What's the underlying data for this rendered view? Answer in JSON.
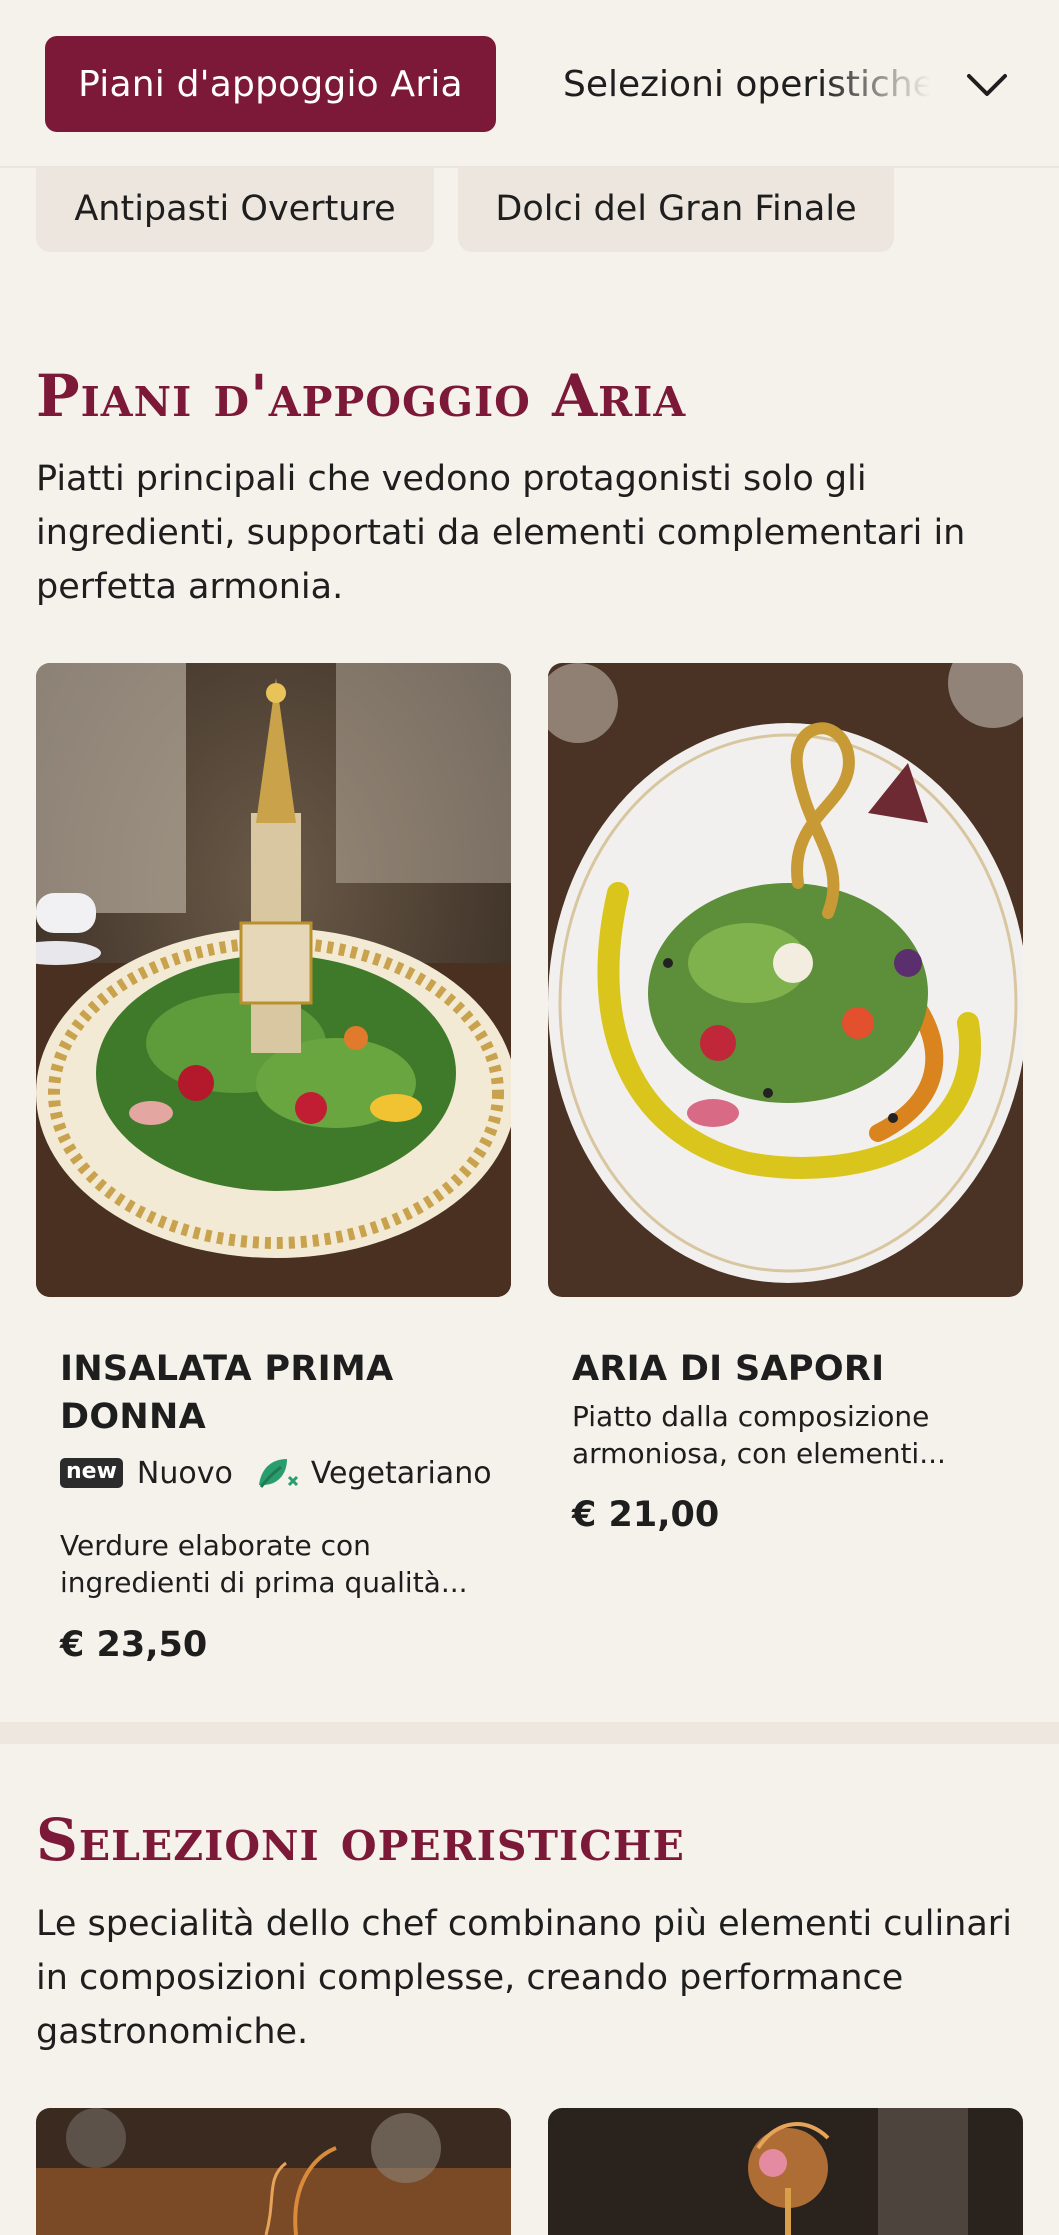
{
  "nav": {
    "active_tab": "Piani d'appoggio Aria",
    "next_tab": "Selezioni operistiche",
    "chevron_icon": "chevron-down-icon",
    "chips": [
      "Antipasti Overture",
      "Dolci del Gran Finale"
    ]
  },
  "colors": {
    "accent": "#7c1938",
    "background": "#f5f1eb",
    "chip": "#ece6df",
    "vegetarian": "#2a9d6f"
  },
  "sections": [
    {
      "title": "Piani d'appoggio Aria",
      "description": "Piatti principali che vedono protagonisti solo gli ingredienti, supportati da elementi complementari in perfetta armonia.",
      "dishes": [
        {
          "name": "INSALATA PRIMA DONNA",
          "badge_new": "new",
          "badge_new_label": "Nuovo",
          "badge_veg_icon": "vegetarian-icon",
          "badge_veg_label": "Vegetariano",
          "description": "Verdure elaborate con ingredienti di prima qualità...",
          "price": "€ 23,50"
        },
        {
          "name": "ARIA DI SAPORI",
          "description": "Piatto dalla composizione armoniosa, con elementi...",
          "price": "€ 21,00"
        }
      ]
    },
    {
      "title": "Selezioni operistiche",
      "description": "Le specialità dello chef combinano più elementi culinari in composizioni complesse, creando performance gastronomiche."
    }
  ]
}
